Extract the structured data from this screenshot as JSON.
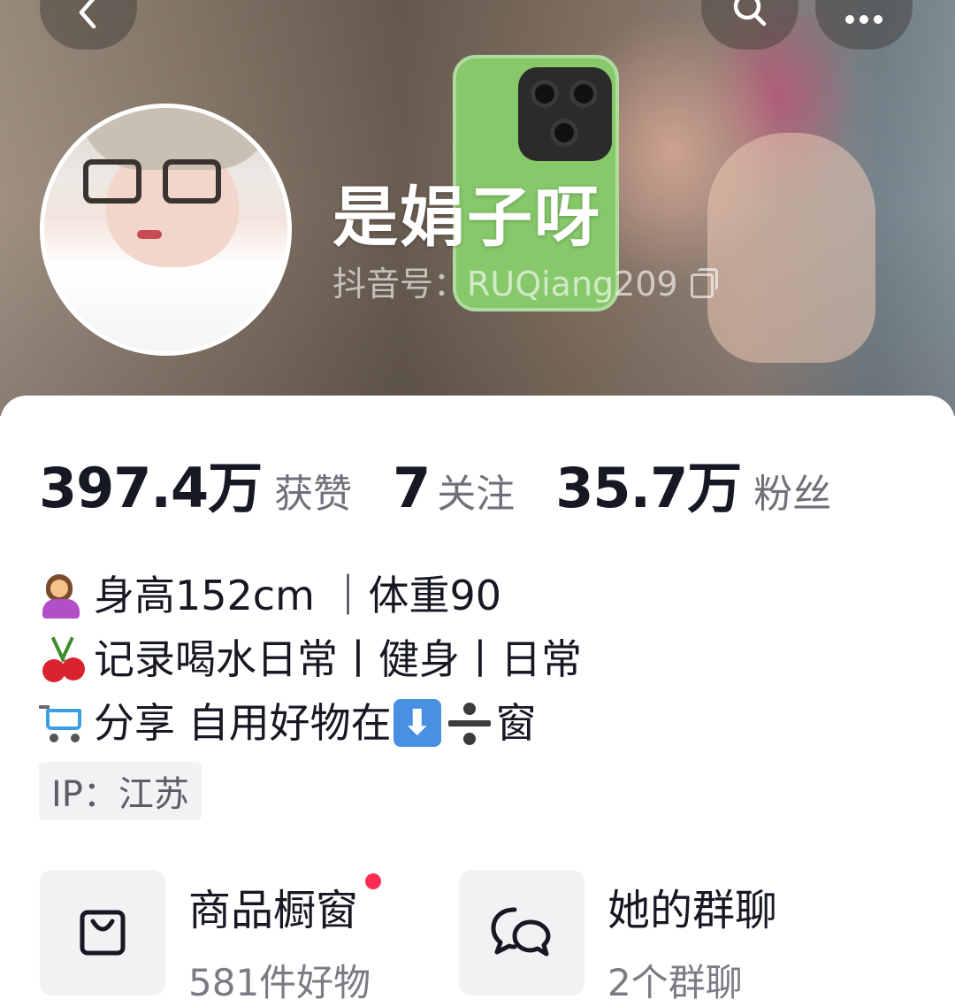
{
  "header": {
    "nickname": "是娟子呀",
    "douyin_id": "抖音号：RUQiang209",
    "icons": [
      "back-icon",
      "search-icon",
      "more-icon",
      "copy-icon"
    ]
  },
  "stats": [
    {
      "value": "397.4万",
      "label": "获赞"
    },
    {
      "value": "7",
      "label": "关注"
    },
    {
      "value": "35.7万",
      "label": "粉丝"
    }
  ],
  "bio": {
    "line1": "身高152cm ｜体重90",
    "line2": "记录喝水日常丨健身丨日常",
    "line3_a": "分享 自用好物在",
    "line3_b": "窗",
    "down_arrow": "⬇",
    "emojis": [
      "person-tipping-hand-emoji",
      "cherries-emoji",
      "shopping-cart-emoji",
      "down-arrow-emoji",
      "divide-emoji"
    ]
  },
  "ip_location": "IP：江苏",
  "entries": [
    {
      "title": "商品橱窗",
      "subtitle": "581件好物",
      "icon": "shopping-bag-icon",
      "has_red_dot": true
    },
    {
      "title": "她的群聊",
      "subtitle": "2个群聊",
      "icon": "chat-bubbles-icon",
      "has_red_dot": false
    }
  ],
  "colors": {
    "accent_red": "#fe2c55",
    "text_primary": "#161823",
    "text_secondary": "#6f7079",
    "tag_bg": "#f2f2f4"
  }
}
